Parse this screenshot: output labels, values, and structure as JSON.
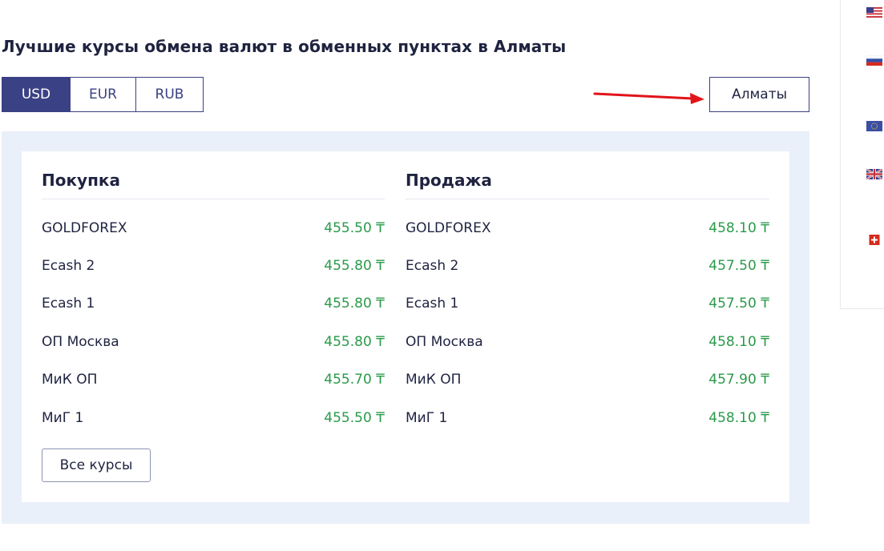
{
  "page_title": "Лучшие курсы обмена валют в обменных пунктах в Алматы",
  "currency_tabs": [
    {
      "label": "USD",
      "active": true
    },
    {
      "label": "EUR",
      "active": false
    },
    {
      "label": "RUB",
      "active": false
    }
  ],
  "city_button": "Алматы",
  "buy": {
    "heading": "Покупка",
    "rows": [
      {
        "name": "GOLDFOREX",
        "value": "455.50 ₸"
      },
      {
        "name": "Ecash 2",
        "value": "455.80 ₸"
      },
      {
        "name": "Ecash 1",
        "value": "455.80 ₸"
      },
      {
        "name": "ОП Москва",
        "value": "455.80 ₸"
      },
      {
        "name": "МиК ОП",
        "value": "455.70 ₸"
      },
      {
        "name": "МиГ 1",
        "value": "455.50 ₸"
      }
    ]
  },
  "sell": {
    "heading": "Продажа",
    "rows": [
      {
        "name": "GOLDFOREX",
        "value": "458.10 ₸"
      },
      {
        "name": "Ecash 2",
        "value": "457.50 ₸"
      },
      {
        "name": "Ecash 1",
        "value": "457.50 ₸"
      },
      {
        "name": "ОП Москва",
        "value": "458.10 ₸"
      },
      {
        "name": "МиК ОП",
        "value": "457.90 ₸"
      },
      {
        "name": "МиГ 1",
        "value": "458.10 ₸"
      }
    ]
  },
  "all_rates_button": "Все курсы",
  "side_flags": [
    "us-flag-icon",
    "russia-flag-icon",
    "eu-flag-icon",
    "uk-flag-icon",
    "switzerland-flag-icon"
  ],
  "colors": {
    "accent": "#3b4185",
    "rate_green": "#2a9a4a",
    "panel_bg": "#e9f0f9",
    "arrow_red": "#e0141a"
  }
}
